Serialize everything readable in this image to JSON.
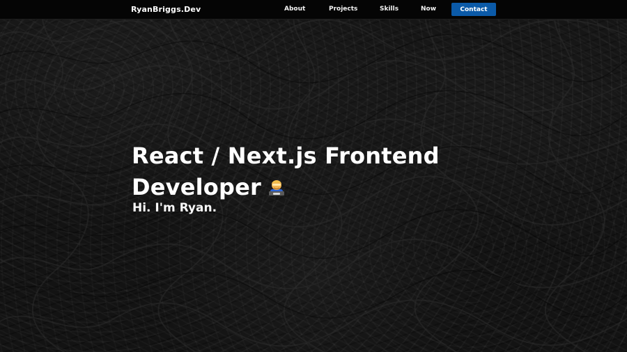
{
  "site": {
    "brand": "RyanBriggs.Dev"
  },
  "nav": {
    "about": "About",
    "projects": "Projects",
    "skills": "Skills",
    "now": "Now",
    "contact": "Contact"
  },
  "hero": {
    "title_line_1": "React / Next.js Frontend",
    "title_line_2": "Developer",
    "subtitle": "Hi. I'm Ryan.",
    "emoji_icon": "technologist-emoji-icon"
  },
  "colors": {
    "background": "#131313",
    "navbar": "#050505",
    "contact_button": "#0b5aa8",
    "text": "#ffffff"
  }
}
